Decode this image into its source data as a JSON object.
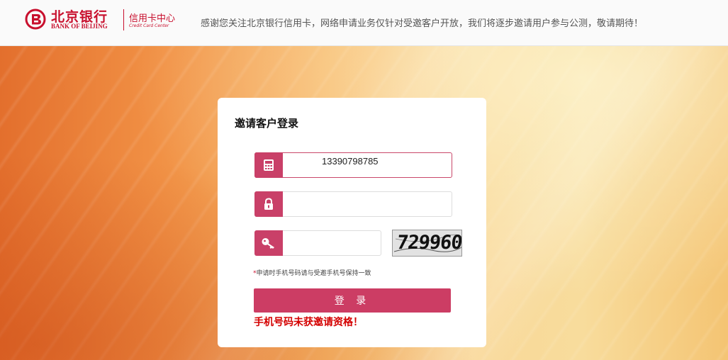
{
  "header": {
    "logo_cn": "北京银行",
    "logo_en": "BANK OF BEIJING",
    "logo_sub_cn": "信用卡中心",
    "logo_sub_en": "Credit Card Center",
    "notice": "感谢您关注北京银行信用卡，网络申请业务仅针对受邀客户开放，我们将逐步邀请用户参与公测，敬请期待！"
  },
  "login": {
    "title": "邀请客户登录",
    "phone_value": "13390798785",
    "password_value": "",
    "captcha_value": "",
    "captcha_image_text": "729960",
    "hint_star": "*",
    "hint": "申请时手机号码请与受邀手机号保持一致",
    "login_button": "登 录",
    "error": "手机号码未获邀请资格！"
  },
  "colors": {
    "brand_red": "#c8102e",
    "button": "#cc3d64",
    "icon_bg": "#c94068",
    "error": "#d40000"
  },
  "icons": {
    "phone_field": "calculator-icon",
    "password_field": "lock-icon",
    "captcha_field": "key-icon",
    "logo": "bank-of-beijing-logo"
  }
}
